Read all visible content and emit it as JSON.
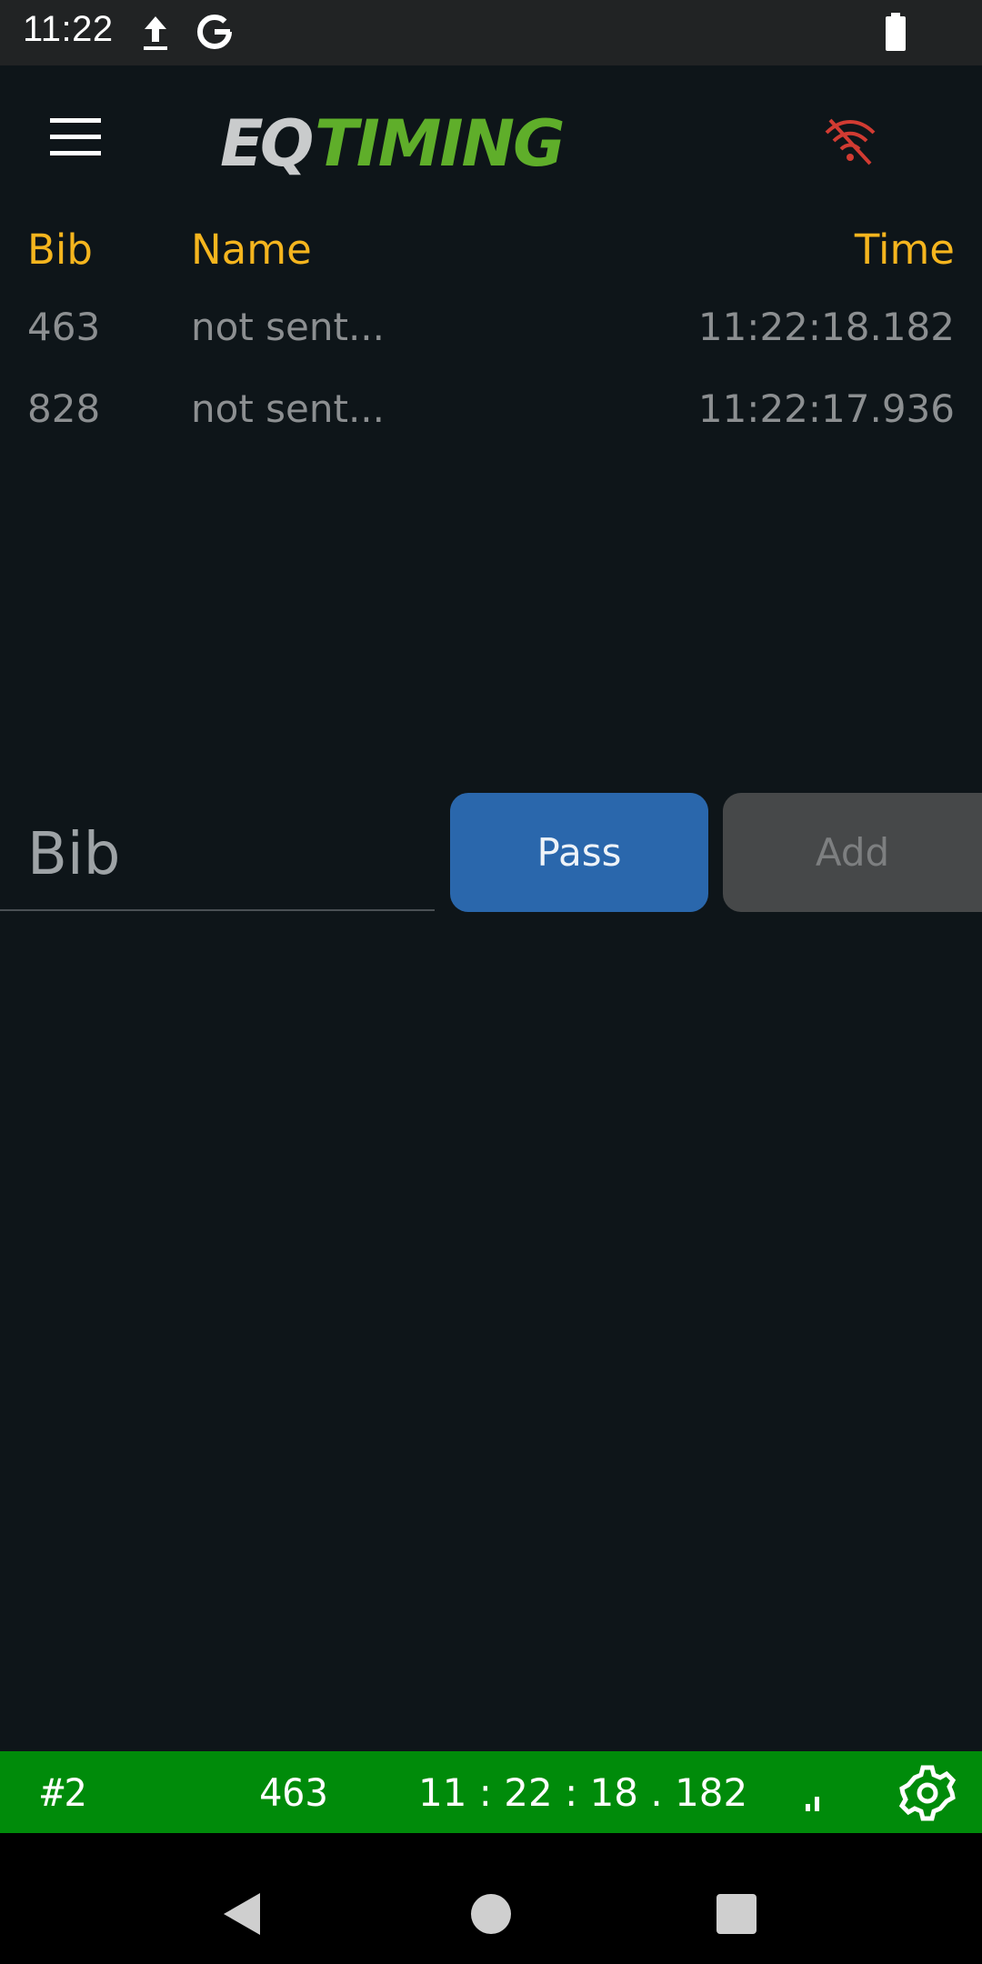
{
  "status_bar": {
    "time": "11:22",
    "icons": [
      "upload-icon",
      "google-icon",
      "battery-icon"
    ]
  },
  "header": {
    "logo_text_part1": "EQ",
    "logo_text_part2": "TIMING",
    "icons": [
      "menu-icon",
      "wifi-off-icon"
    ],
    "wifi_off_color": "#d13b32"
  },
  "table": {
    "columns": [
      "Bib",
      "Name",
      "Time"
    ],
    "rows": [
      {
        "bib": "463",
        "name": "not sent...",
        "time": "11:22:18.182"
      },
      {
        "bib": "828",
        "name": "not sent...",
        "time": "11:22:17.936"
      }
    ],
    "header_color": "#f5b51e"
  },
  "entry": {
    "bib_placeholder": "Bib",
    "pass_label": "Pass",
    "add_label": "Add",
    "pass_color": "#2a67ac"
  },
  "info_bar": {
    "position": "#2",
    "bib": "463",
    "time": "11 : 22 : 18 . 182",
    "icons": [
      "signal-icon",
      "settings-icon"
    ],
    "color": "#008b0a"
  },
  "nav": {
    "icons": [
      "back-icon",
      "home-icon",
      "recents-icon"
    ]
  }
}
